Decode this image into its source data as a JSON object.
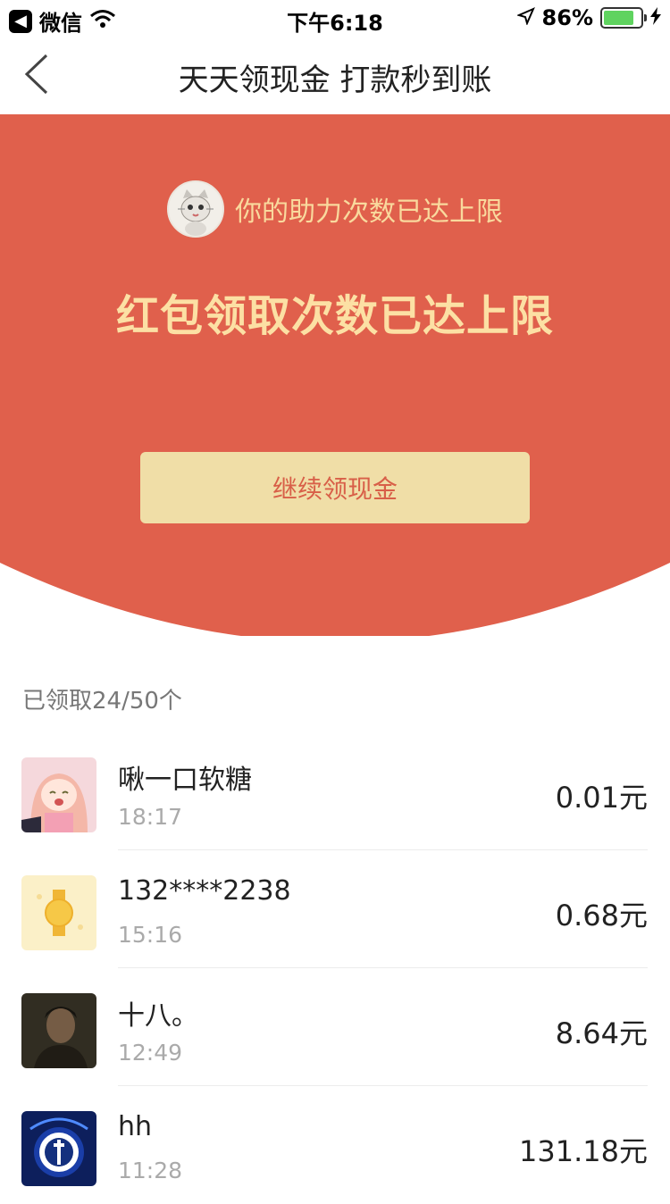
{
  "status_bar": {
    "back_app_label": "微信",
    "time": "下午6:18",
    "battery_percent": "86%",
    "battery_level": 0.86
  },
  "nav": {
    "title": "天天领现金 打款秒到账"
  },
  "hero": {
    "limit_notice": "你的助力次数已达上限",
    "headline": "红包领取次数已达上限",
    "cta_label": "继续领现金",
    "colors": {
      "background": "#e0604c",
      "headline": "#fce0a4",
      "cta_bg": "#f0dea7",
      "cta_text": "#d85f48"
    }
  },
  "claims": {
    "count_label": "已领取24/50个",
    "items": [
      {
        "name": "啾一口软糖",
        "time": "18:17",
        "amount": "0.01元",
        "avatar_icon": "anime-girl-avatar"
      },
      {
        "name": "132****2238",
        "time": "15:16",
        "amount": "0.68元",
        "avatar_icon": "yellow-watch-avatar"
      },
      {
        "name": "十八。",
        "time": "12:49",
        "amount": "8.64元",
        "avatar_icon": "dark-photo-avatar"
      },
      {
        "name": "hh",
        "time": "11:28",
        "amount": "131.18元",
        "avatar_icon": "blue-logo-avatar"
      }
    ]
  }
}
